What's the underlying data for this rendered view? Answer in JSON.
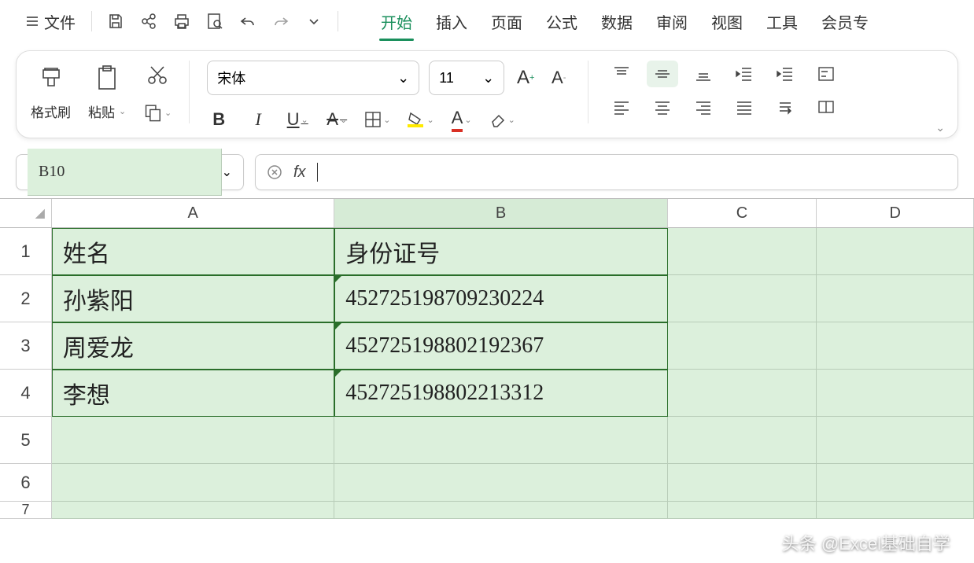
{
  "menu": {
    "file": "文件",
    "tabs": [
      "开始",
      "插入",
      "页面",
      "公式",
      "数据",
      "审阅",
      "视图",
      "工具",
      "会员专"
    ]
  },
  "ribbon": {
    "format_painter": "格式刷",
    "paste": "粘贴",
    "font_name": "宋体",
    "font_size": "11"
  },
  "namebox": {
    "ref": "B10"
  },
  "formula": {
    "label": "fx",
    "value": ""
  },
  "grid": {
    "columns": [
      "A",
      "B",
      "C",
      "D"
    ],
    "rows": [
      "1",
      "2",
      "3",
      "4",
      "5",
      "6",
      "7"
    ],
    "data": {
      "A1": "姓名",
      "B1": "身份证号",
      "A2": "孙紫阳",
      "B2": "452725198709230224",
      "A3": "周爱龙",
      "B3": "452725198802192367",
      "A4": "李想",
      "B4": "452725198802213312"
    }
  },
  "watermark": "头条 @Excel基础自学"
}
